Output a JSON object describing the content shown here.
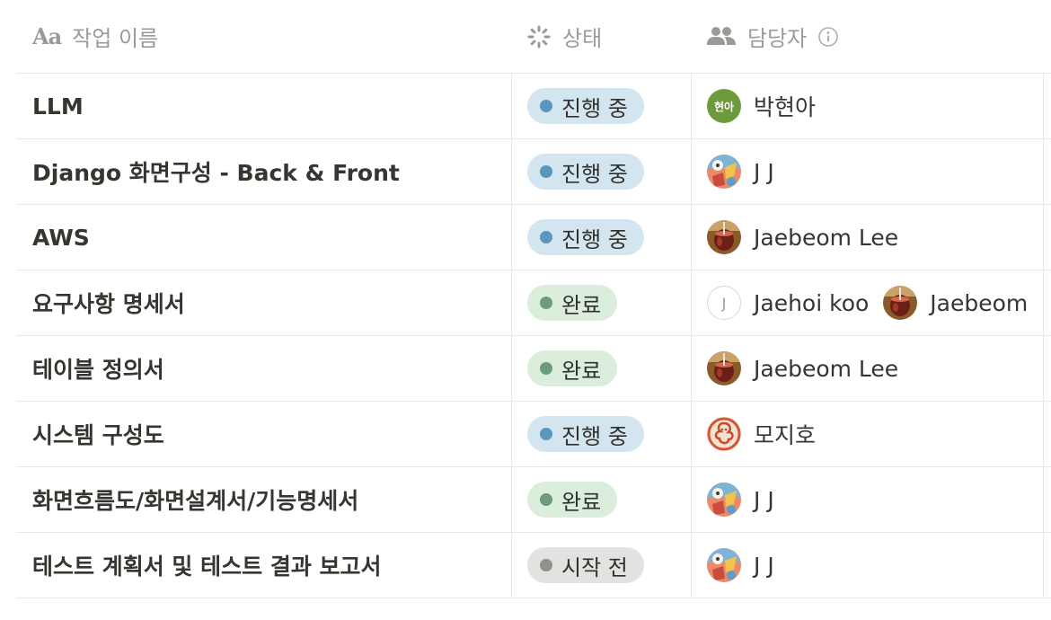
{
  "columns": {
    "name": "작업 이름",
    "status": "상태",
    "owner": "담당자"
  },
  "status_colors": {
    "진행 중": {
      "bg": "#d3e5ef",
      "dot": "#5b97bd"
    },
    "완료": {
      "bg": "#dbeddb",
      "dot": "#6c9b7d"
    },
    "시작 전": {
      "bg": "#e3e2e0",
      "dot": "#91918e"
    }
  },
  "rows": [
    {
      "name": "LLM",
      "status": "진행 중",
      "owners": [
        {
          "name": "박현아",
          "avatar": "initials",
          "initials": "현아"
        }
      ]
    },
    {
      "name": "Django 화면구성 - Back & Front",
      "status": "진행 중",
      "owners": [
        {
          "name": "J J",
          "avatar": "photo-cartoon-icon"
        }
      ]
    },
    {
      "name": "AWS",
      "status": "진행 중",
      "owners": [
        {
          "name": "Jaebeom Lee",
          "avatar": "photo-drink-icon"
        }
      ]
    },
    {
      "name": "요구사항 명세서",
      "status": "완료",
      "owners": [
        {
          "name": "Jaehoi koo",
          "avatar": "letter",
          "initials": "J"
        },
        {
          "name": "Jaebeom",
          "avatar": "photo-drink-icon"
        }
      ]
    },
    {
      "name": "테이블 정의서",
      "status": "완료",
      "owners": [
        {
          "name": "Jaebeom Lee",
          "avatar": "photo-drink-icon"
        }
      ]
    },
    {
      "name": "시스템 구성도",
      "status": "진행 중",
      "owners": [
        {
          "name": "모지호",
          "avatar": "photo-pretzel-icon"
        }
      ]
    },
    {
      "name": "화면흐름도/화면설계서/기능명세서",
      "status": "완료",
      "owners": [
        {
          "name": "J J",
          "avatar": "photo-cartoon-icon"
        }
      ]
    },
    {
      "name": "테스트 계획서 및 테스트 결과 보고서",
      "status": "시작 전",
      "owners": [
        {
          "name": "J J",
          "avatar": "photo-cartoon-icon"
        }
      ]
    }
  ]
}
